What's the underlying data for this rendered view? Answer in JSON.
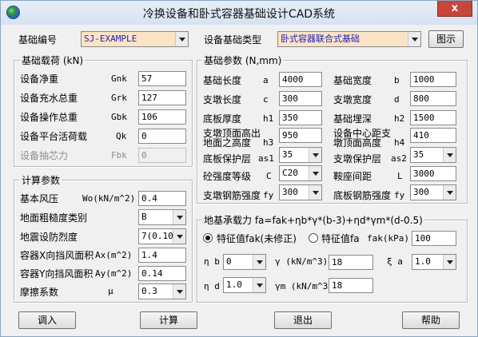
{
  "window": {
    "title": "冷换设备和卧式容器基础设计CAD系统",
    "close_glyph": "x"
  },
  "top": {
    "foundation_no_label": "基础编号",
    "foundation_no_value": "SJ-EXAMPLE",
    "equip_type_label": "设备基础类型",
    "equip_type_value": "卧式容器联合式基础",
    "diagram_button": "图示"
  },
  "loads": {
    "title": "基础载荷 (kN)",
    "rows": [
      {
        "label": "设备净重",
        "sym": "Gnk",
        "value": "57"
      },
      {
        "label": "设备充水总重",
        "sym": "Grk",
        "value": "127"
      },
      {
        "label": "设备操作总重",
        "sym": "Gbk",
        "value": "106"
      },
      {
        "label": "设备平台活荷载",
        "sym": "Qk",
        "value": "0"
      },
      {
        "label": "设备抽芯力",
        "sym": "Fbk",
        "value": "0"
      }
    ]
  },
  "calc": {
    "title": "计算参数",
    "basic_wind_label": "基本风压",
    "basic_wind_sym": "Wo(kN/m^2)",
    "basic_wind_value": "0.4",
    "roughness_label": "地面粗糙度类别",
    "roughness_value": "B",
    "seismic_label": "地震设防烈度",
    "seismic_value": "7(0.10",
    "windx_label": "容器X向挡风面积",
    "windx_sym": "Ax(m^2)",
    "windx_value": "1.4",
    "windy_label": "容器Y向挡风面积",
    "windy_sym": "Ay(m^2)",
    "windy_value": "0.14",
    "friction_label": "摩擦系数",
    "friction_sym": "μ",
    "friction_value": "0.3"
  },
  "params": {
    "title": "基础参数 (N,mm)",
    "left": [
      {
        "label": "基础长度",
        "sym": "a",
        "value": "4000",
        "type": "text"
      },
      {
        "label": "支墩长度",
        "sym": "c",
        "value": "300",
        "type": "text"
      },
      {
        "label": "底板厚度",
        "sym": "h1",
        "value": "350",
        "type": "text"
      },
      {
        "label": "支墩顶面高出",
        "label2": "地面之高度",
        "sym": "h3",
        "value": "950",
        "type": "text"
      },
      {
        "label": "底板保护层",
        "sym": "as1",
        "value": "35",
        "type": "combo"
      },
      {
        "label": "砼强度等级",
        "sym": "C",
        "value": "C20",
        "type": "combo"
      },
      {
        "label": "支墩钢筋强度",
        "sym": "fy",
        "value": "300",
        "type": "combo"
      }
    ],
    "right": [
      {
        "label": "基础宽度",
        "sym": "b",
        "value": "1000",
        "type": "text"
      },
      {
        "label": "支墩宽度",
        "sym": "d",
        "value": "800",
        "type": "text"
      },
      {
        "label": "基础埋深",
        "sym": "h2",
        "value": "1500",
        "type": "text"
      },
      {
        "label": "设备中心距支",
        "label2": "墩顶面高度",
        "sym": "h4",
        "value": "410",
        "type": "text"
      },
      {
        "label": "支墩保护层",
        "sym": "as2",
        "value": "35",
        "type": "combo"
      },
      {
        "label": "鞍座间距",
        "sym": "L",
        "value": "3000",
        "type": "text"
      },
      {
        "label": "底板钢筋强度",
        "sym": "fy",
        "value": "300",
        "type": "combo"
      }
    ]
  },
  "bearing": {
    "title": "地基承载力 fa=fak+ηb*γ*(b-3)+ηd*γm*(d-0.5)",
    "radio_char": "特征值fak(未修正)",
    "radio_fa": "特征值fa",
    "fak_sym": "fak(kPa)",
    "fak_value": "100",
    "etab_sym": "η b",
    "etab_value": "0",
    "gamma_sym": "γ (kN/m^3)",
    "gamma_value": "18",
    "xi_sym": "ξ a",
    "xi_value": "1.0",
    "etad_sym": "η d",
    "etad_value": "1.0",
    "gammam_sym": "γm (kN/m^3)",
    "gammam_value": "18"
  },
  "buttons": {
    "import": "调入",
    "compute": "计算",
    "exit": "退出",
    "help": "帮助"
  },
  "colors": {
    "accent_field_bg": "#fbe4c6",
    "accent_field_text": "#1d1db8",
    "close_red": "#c7463a"
  }
}
